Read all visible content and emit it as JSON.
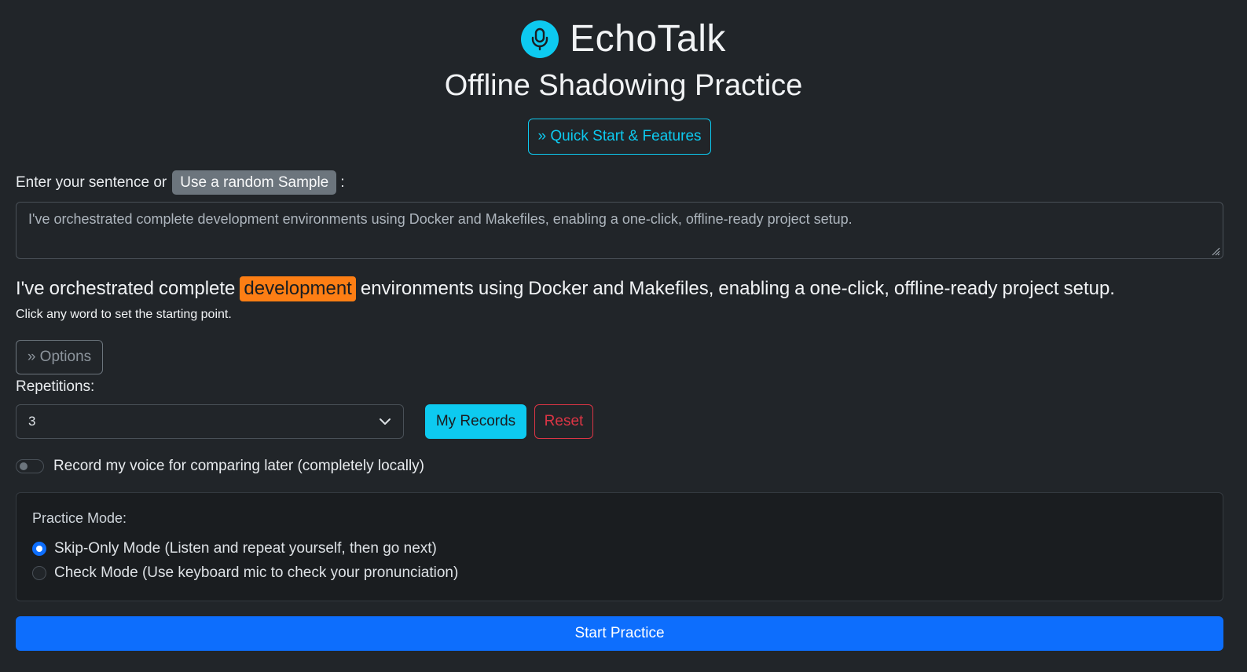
{
  "header": {
    "app_name": "EchoTalk",
    "subtitle": "Offline Shadowing Practice",
    "quick_start_label": "» Quick Start & Features",
    "mic_icon": "microphone-icon",
    "accent_color": "#0dcaf0"
  },
  "input": {
    "prompt_text": "Enter your sentence or",
    "sample_button_label": "Use a random Sample",
    "prompt_suffix": ":",
    "sentence_value": "I've orchestrated complete development environments using Docker and Makefiles, enabling a one-click, offline-ready project setup."
  },
  "sentence": {
    "words": [
      {
        "text": "I've",
        "active": false
      },
      {
        "text": "orchestrated",
        "active": false
      },
      {
        "text": "complete",
        "active": false
      },
      {
        "text": "development",
        "active": true
      },
      {
        "text": "environments",
        "active": false
      },
      {
        "text": "using",
        "active": false
      },
      {
        "text": "Docker",
        "active": false
      },
      {
        "text": "and",
        "active": false
      },
      {
        "text": "Makefiles,",
        "active": false
      },
      {
        "text": "enabling",
        "active": false
      },
      {
        "text": "a",
        "active": false
      },
      {
        "text": "one-click,",
        "active": false
      },
      {
        "text": "offline-ready",
        "active": false
      },
      {
        "text": "project",
        "active": false
      },
      {
        "text": "setup.",
        "active": false
      }
    ],
    "highlight_color": "#fd7e14",
    "hint": "Click any word to set the starting point."
  },
  "options": {
    "toggle_label": "» Options",
    "repetitions_label": "Repetitions:",
    "repetitions_value": "3",
    "my_records_label": "My Records",
    "reset_label": "Reset",
    "record_toggle_label": "Record my voice for comparing later (completely locally)",
    "record_enabled": false
  },
  "practice_mode": {
    "label": "Practice Mode:",
    "modes": [
      {
        "label": "Skip-Only Mode (Listen and repeat yourself, then go next)",
        "checked": true
      },
      {
        "label": "Check Mode (Use keyboard mic to check your pronunciation)",
        "checked": false
      }
    ]
  },
  "actions": {
    "start_label": "Start Practice",
    "primary_color": "#0d6efd"
  }
}
